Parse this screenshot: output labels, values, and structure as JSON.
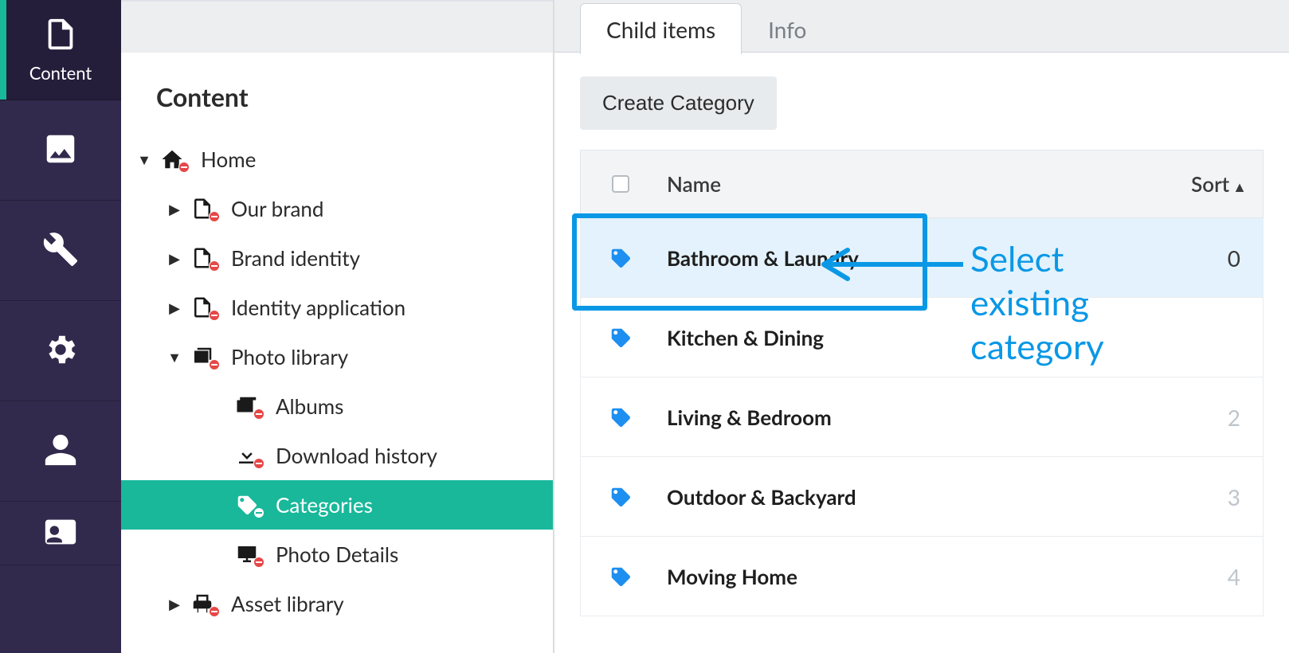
{
  "rail": {
    "items": [
      {
        "key": "content",
        "label": "Content",
        "showLabel": true,
        "active": true
      },
      {
        "key": "media",
        "label": "",
        "showLabel": false,
        "active": false
      },
      {
        "key": "tools",
        "label": "",
        "showLabel": false,
        "active": false
      },
      {
        "key": "settings",
        "label": "",
        "showLabel": false,
        "active": false
      },
      {
        "key": "users",
        "label": "",
        "showLabel": false,
        "active": false
      },
      {
        "key": "card",
        "label": "",
        "showLabel": false,
        "active": false
      }
    ]
  },
  "tree": {
    "heading": "Content",
    "nodes": [
      {
        "label": "Home",
        "level": 0,
        "icon": "home",
        "caret": "down",
        "selected": false
      },
      {
        "label": "Our brand",
        "level": 1,
        "icon": "page",
        "caret": "right",
        "selected": false
      },
      {
        "label": "Brand identity",
        "level": 1,
        "icon": "page",
        "caret": "right",
        "selected": false
      },
      {
        "label": "Identity application",
        "level": 1,
        "icon": "page",
        "caret": "right",
        "selected": false
      },
      {
        "label": "Photo library",
        "level": 1,
        "icon": "photos",
        "caret": "down",
        "selected": false
      },
      {
        "label": "Albums",
        "level": 2,
        "icon": "albums",
        "caret": "none",
        "selected": false
      },
      {
        "label": "Download history",
        "level": 2,
        "icon": "download",
        "caret": "none",
        "selected": false
      },
      {
        "label": "Categories",
        "level": 2,
        "icon": "tags",
        "caret": "none",
        "selected": true
      },
      {
        "label": "Photo Details",
        "level": 2,
        "icon": "screen",
        "caret": "none",
        "selected": false
      },
      {
        "label": "Asset library",
        "level": 1,
        "icon": "printer",
        "caret": "right",
        "selected": false
      }
    ]
  },
  "tabs": {
    "items": [
      {
        "label": "Child items",
        "active": true
      },
      {
        "label": "Info",
        "active": false
      }
    ]
  },
  "toolbar": {
    "create_label": "Create Category"
  },
  "table": {
    "headers": {
      "name": "Name",
      "sort": "Sort"
    },
    "rows": [
      {
        "name": "Bathroom & Laundry",
        "sort": "0",
        "highlight": true
      },
      {
        "name": "Kitchen & Dining",
        "sort": "",
        "highlight": false
      },
      {
        "name": "Living & Bedroom",
        "sort": "2",
        "highlight": false
      },
      {
        "name": "Outdoor & Backyard",
        "sort": "3",
        "highlight": false
      },
      {
        "name": "Moving Home",
        "sort": "4",
        "highlight": false
      }
    ]
  },
  "annotation": {
    "text_line1": "Select",
    "text_line2": "existing",
    "text_line3": "category"
  }
}
